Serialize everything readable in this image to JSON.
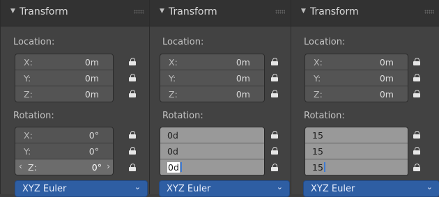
{
  "panels": [
    {
      "title": "Transform",
      "location_label": "Location:",
      "location": [
        {
          "axis": "X:",
          "value": "0m"
        },
        {
          "axis": "Y:",
          "value": "0m"
        },
        {
          "axis": "Z:",
          "value": "0m"
        }
      ],
      "rotation_label": "Rotation:",
      "rotation": [
        {
          "axis": "X:",
          "value": "0°"
        },
        {
          "axis": "Y:",
          "value": "0°"
        },
        {
          "axis": "Z:",
          "value": "0°",
          "nav_left": "‹",
          "nav_right": "›"
        }
      ],
      "rotation_mode": "XYZ Euler"
    },
    {
      "title": "Transform",
      "location_label": "Location:",
      "location": [
        {
          "axis": "X:",
          "value": "0m"
        },
        {
          "axis": "Y:",
          "value": "0m"
        },
        {
          "axis": "Z:",
          "value": "0m"
        }
      ],
      "rotation_label": "Rotation:",
      "rotation_edit": [
        "0d",
        "0d",
        "0d"
      ],
      "rotation_mode": "XYZ Euler"
    },
    {
      "title": "Transform",
      "location_label": "Location:",
      "location": [
        {
          "axis": "X:",
          "value": "0m"
        },
        {
          "axis": "Y:",
          "value": "0m"
        },
        {
          "axis": "Z:",
          "value": "0m"
        }
      ],
      "rotation_label": "Rotation:",
      "rotation_edit": [
        "15",
        "15",
        "15"
      ],
      "rotation_mode": "XYZ Euler"
    }
  ],
  "icons": {
    "collapse": "triangle-down-icon",
    "drag": "drag-grip-icon",
    "lock": "lock-icon",
    "dropdown": "chevron-down-icon"
  },
  "colors": {
    "panel_bg": "#424242",
    "header_bg": "#323232",
    "field_bg": "#545454",
    "edit_field_bg": "#999999",
    "dropdown_bg": "#2e5ea3",
    "caret": "#3e7bd4"
  }
}
